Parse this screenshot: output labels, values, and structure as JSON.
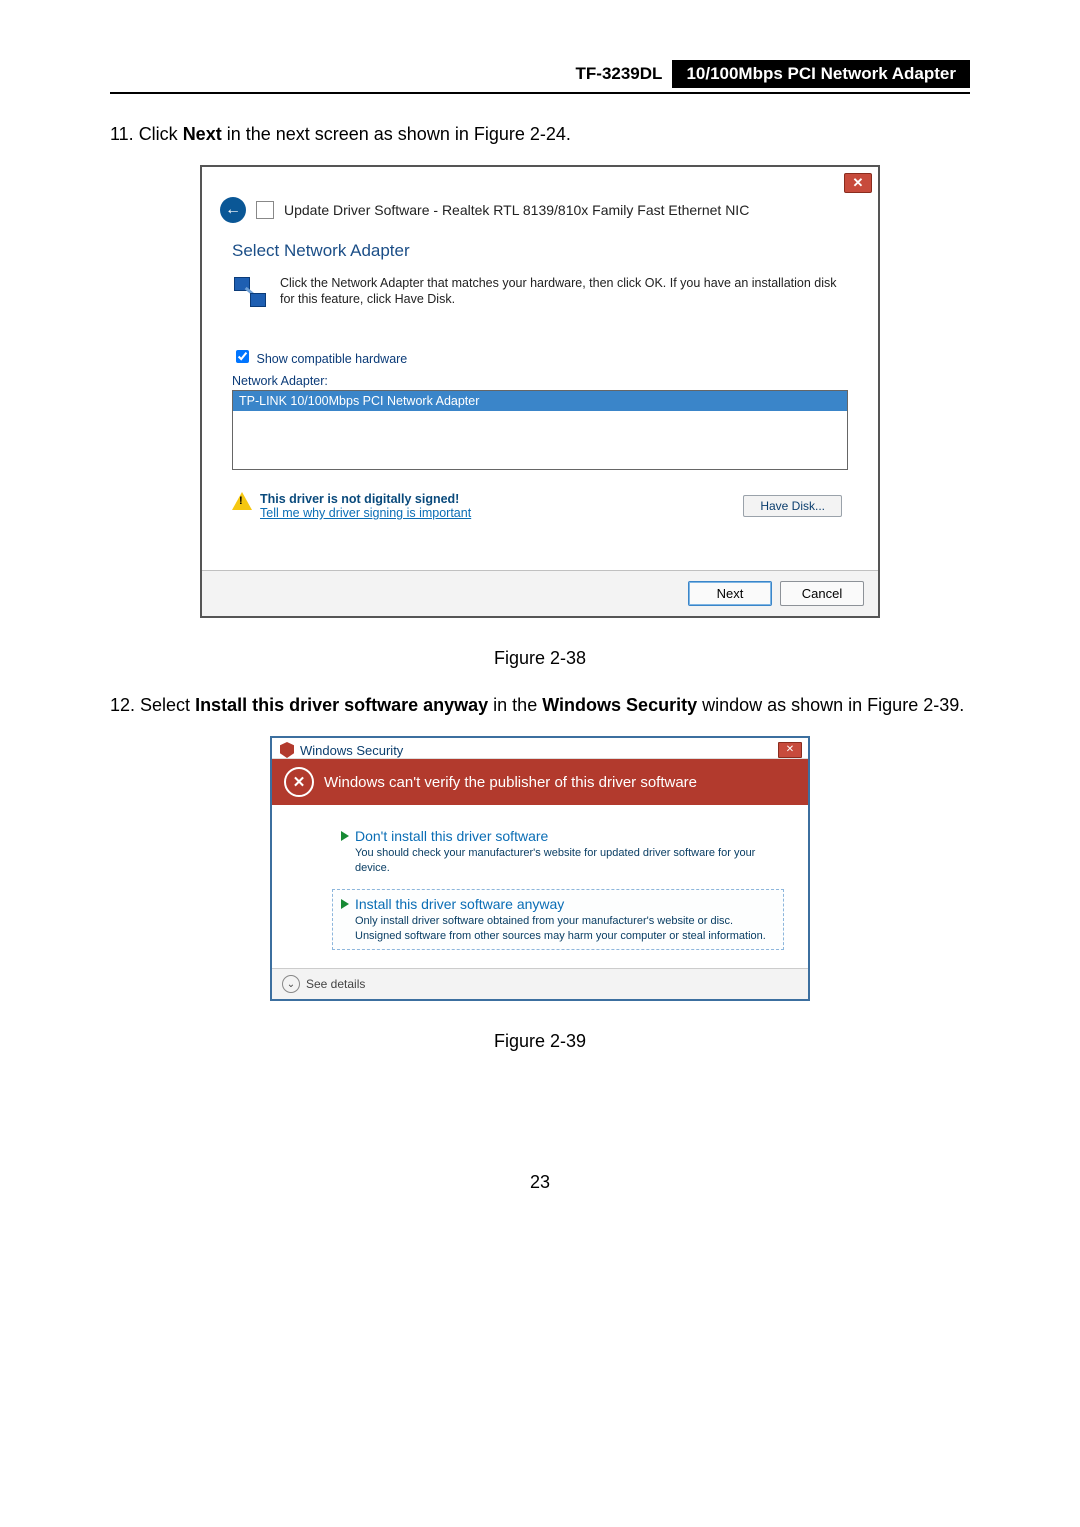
{
  "header": {
    "model": "TF-3239DL",
    "title": "10/100Mbps PCI Network Adapter"
  },
  "step11": {
    "prefix": "11.  Click ",
    "bold": "Next",
    "suffix": " in the next screen as shown in Figure 2-24."
  },
  "window1": {
    "title": "Update Driver Software - Realtek RTL 8139/810x Family Fast Ethernet NIC",
    "heading": "Select Network Adapter",
    "description": "Click the Network Adapter that matches your hardware, then click OK. If you have an installation disk for this feature, click Have Disk.",
    "show_compatible": "Show compatible hardware",
    "network_adapter_label": "Network Adapter:",
    "list_item": "TP-LINK 10/100Mbps PCI Network Adapter",
    "not_signed": "This driver is not digitally signed!",
    "tell_me": "Tell me why driver signing is important",
    "have_disk": "Have Disk...",
    "next": "Next",
    "cancel": "Cancel"
  },
  "caption1": "Figure 2-38",
  "step12": {
    "prefix": "12.  Select ",
    "bold1": "Install this driver software anyway",
    "mid": " in the ",
    "bold2": "Windows Security",
    "suffix": " window as shown in Figure 2-39."
  },
  "window2": {
    "titlebar": "Windows Security",
    "banner": "Windows can't verify the publisher of this driver software",
    "opt1_title": "Don't install this driver software",
    "opt1_desc": "You should check your manufacturer's website for updated driver software for your device.",
    "opt2_title": "Install this driver software anyway",
    "opt2_desc": "Only install driver software obtained from your manufacturer's website or disc. Unsigned software from other sources may harm your computer or steal information.",
    "see_details": "See details"
  },
  "caption2": "Figure 2-39",
  "page_number": "23"
}
